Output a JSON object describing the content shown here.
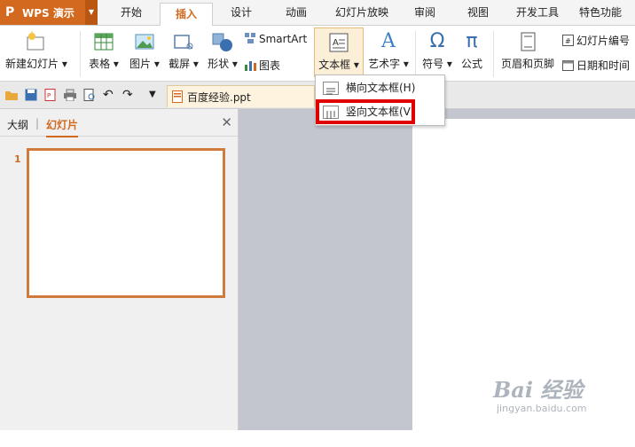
{
  "app": {
    "logo": "P",
    "title": "WPS 演示"
  },
  "menu_tabs": [
    {
      "label": "开始"
    },
    {
      "label": "插入"
    },
    {
      "label": "设计"
    },
    {
      "label": "动画"
    },
    {
      "label": "幻灯片放映"
    },
    {
      "label": "审阅"
    },
    {
      "label": "视图"
    },
    {
      "label": "开发工具"
    },
    {
      "label": "特色功能"
    }
  ],
  "active_tab": "插入",
  "ribbon": {
    "new_slide": "新建幻灯片",
    "table": "表格",
    "picture": "图片",
    "screenshot": "截屏",
    "shapes": "形状",
    "smartart": "SmartArt",
    "chart": "图表",
    "textbox": "文本框",
    "wordart": "艺术字",
    "symbol": "符号",
    "formula": "公式",
    "header_footer": "页眉和页脚",
    "slide_number": "幻灯片编号",
    "datetime": "日期和时间"
  },
  "file": {
    "name": "百度经验.ppt"
  },
  "dropdown": {
    "horizontal": "横向文本框(H)",
    "vertical": "竖向文本框(V)"
  },
  "left_pane": {
    "outline_tab": "大纲",
    "divider": "|",
    "slides_tab": "幻灯片",
    "close": "✕"
  },
  "slides": [
    {
      "number": "1"
    }
  ],
  "watermark": {
    "brand": "Bai 经验",
    "url": "jingyan.baidu.com"
  },
  "colors": {
    "accent": "#d2691e",
    "highlight": "#e00000",
    "workspace": "#c3c6ce"
  }
}
